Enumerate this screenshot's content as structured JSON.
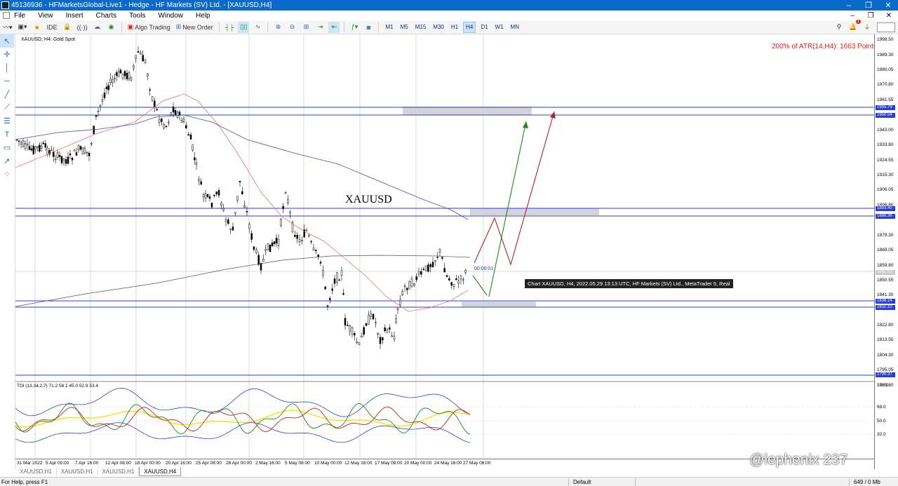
{
  "window": {
    "title": "45136936 - HFMarketsGlobal-Live1 - Hedge - HF Markets (SV) Ltd. - [XAUUSD,H4]",
    "controls": [
      "–",
      "❐",
      "✕"
    ]
  },
  "menu": {
    "items": [
      "File",
      "View",
      "Insert",
      "Charts",
      "Tools",
      "Window",
      "Help"
    ]
  },
  "toolbar": {
    "ide_label": "IDE",
    "algo_trading_label": "Algo Trading",
    "new_order_label": "New Order",
    "timeframes": [
      "M1",
      "M5",
      "M15",
      "M30",
      "H1",
      "H4",
      "D1",
      "W1",
      "MN"
    ],
    "active_timeframe": "H4",
    "notification_count": "1"
  },
  "chart": {
    "symbol_label": "XAUUSD, H4:  Gold Spot",
    "atr_text": "200% of ATR(14,H4): 1663  Points",
    "annotation_text": "XAUUSD",
    "countdown": "00:00:01",
    "tooltip": "Chart XAUUSD, H4, 2022.05.29 13:13 UTC, HF Markets (SV) Ltd., MetaTrader 5, Real",
    "indicator_label": "TDI (13,34,2,7) 71.2 58.1 45.0 52.9 53.4",
    "accent_blue": "#2a3dd6",
    "zone_grey": "#d4d4d8",
    "up_arrow_color": "#1b8a1b",
    "down_arrow_color": "#b0202a"
  },
  "price_axis": {
    "ticks": [
      "1998.50",
      "1989.30",
      "1980.05",
      "1970.80",
      "1961.55",
      "1943.00",
      "1933.80",
      "1924.55",
      "1915.30",
      "1906.05",
      "1896.80",
      "1878.30",
      "1869.05",
      "1859.80",
      "1850.55",
      "1841.30",
      "1822.80",
      "1813.55",
      "1804.30",
      "1795.05",
      "1785.80"
    ],
    "badges": [
      "1955.79",
      "1950.54",
      "1893.40",
      "1888.36",
      "1852.53",
      "1836.14",
      "1832.10",
      "1790.37"
    ],
    "tdi_ticks": [
      "100.0",
      "68.0",
      "50.0",
      "32.0"
    ]
  },
  "time_axis": {
    "labels": [
      "31 Mar 2022",
      "5 Apr 00:00",
      "7 Apr 16:00",
      "12 Apr 08:00",
      "18 Apr 00:00",
      "20 Apr 16:00",
      "25 Apr 08:00",
      "28 Apr 00:00",
      "2 May 16:00",
      "5 May 08:00",
      "10 May 00:00",
      "12 May 16:00",
      "17 May 08:00",
      "20 May 00:00",
      "24 May 16:00",
      "27 May 08:00"
    ]
  },
  "tabs": [
    "XAUUSD,H1",
    "XAUUSD,H1",
    "XAUUSD,H1",
    "XAUUSD,H4"
  ],
  "status": {
    "help": "For Help, press F1",
    "profile": "Default",
    "traffic": "649 / 0 Mb"
  },
  "watermark": "@lephenix 237"
}
